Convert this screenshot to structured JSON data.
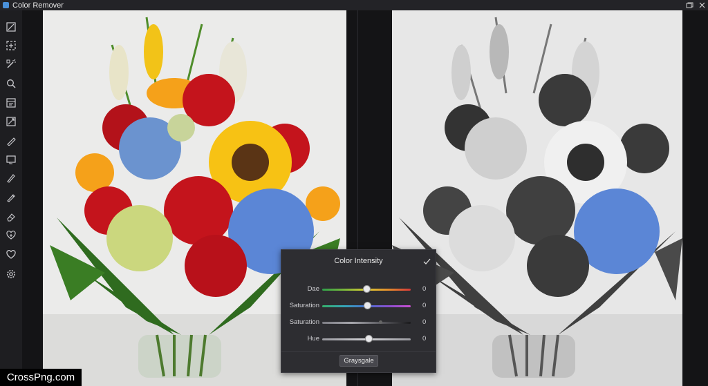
{
  "window": {
    "title": "Color Remover"
  },
  "panel": {
    "title": "Color Intensity",
    "sliders": [
      {
        "label": "Dae",
        "value": "0",
        "level": 0.5
      },
      {
        "label": "Saturation",
        "value": "0",
        "level": 0.51
      },
      {
        "label": "Saturation",
        "value": "0",
        "level": 0.66
      },
      {
        "label": "Hue",
        "value": "0",
        "level": 0.52
      }
    ],
    "button_label": "Graysgale"
  },
  "watermark": "CrossPng.com",
  "colors": {
    "accent": "#4a90d9",
    "panel_bg": "#2d2d31",
    "toolbar_bg": "#1e1e21"
  },
  "toolbar_icons": [
    "crop-icon",
    "select-add-icon",
    "magic-wand-icon",
    "zoom-icon",
    "panel-icon",
    "transform-icon",
    "brush-icon",
    "frame-icon",
    "pencil-icon",
    "pen-icon",
    "eraser-icon",
    "heal-icon",
    "favorite-icon",
    "settings-icon"
  ]
}
